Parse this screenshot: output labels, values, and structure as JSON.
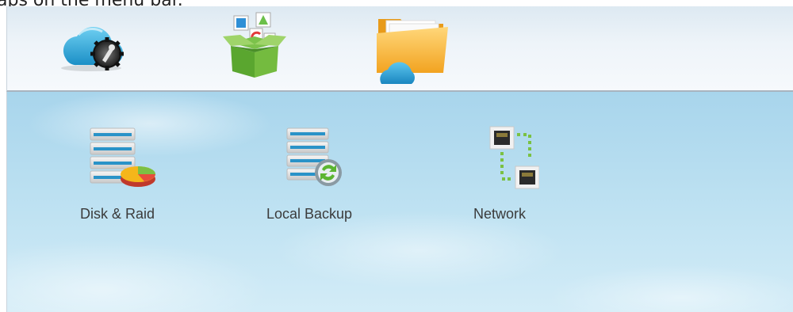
{
  "caption": {
    "text": "aps on the menu bar."
  },
  "menubar": {
    "items": [
      {
        "icon": "cloud-settings-icon"
      },
      {
        "icon": "app-box-icon"
      },
      {
        "icon": "cloud-folder-icon"
      }
    ]
  },
  "desktop": {
    "apps": [
      {
        "label": "Disk & Raid",
        "icon": "disk-raid-icon"
      },
      {
        "label": "Local Backup",
        "icon": "local-backup-icon"
      },
      {
        "label": "Network",
        "icon": "network-icon"
      }
    ]
  },
  "colors": {
    "menubar_bg": "#eef4f9",
    "desktop_sky": "#bfe2f2",
    "label_text": "#3b3b3b"
  }
}
